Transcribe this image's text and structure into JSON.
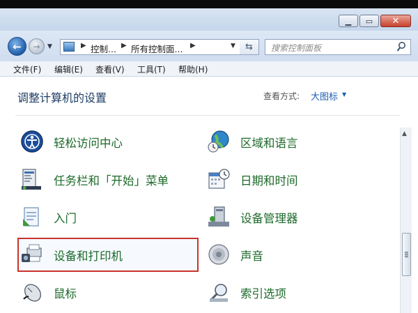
{
  "address_bar": {
    "crumbs": [
      "控制...",
      "所有控制面..."
    ]
  },
  "search": {
    "placeholder": "搜索控制面板"
  },
  "menu": [
    "文件(F)",
    "编辑(E)",
    "查看(V)",
    "工具(T)",
    "帮助(H)"
  ],
  "content": {
    "title": "调整计算机的设置",
    "view_by_label": "查看方式:",
    "view_by_value": "大图标"
  },
  "items": [
    {
      "label": "轻松访问中心",
      "icon": "ease-of-access-icon"
    },
    {
      "label": "区域和语言",
      "icon": "region-language-icon"
    },
    {
      "label": "任务栏和「开始」菜单",
      "icon": "taskbar-start-menu-icon"
    },
    {
      "label": "日期和时间",
      "icon": "date-time-icon"
    },
    {
      "label": "入门",
      "icon": "getting-started-icon"
    },
    {
      "label": "设备管理器",
      "icon": "device-manager-icon"
    },
    {
      "label": "设备和打印机",
      "icon": "devices-printers-icon"
    },
    {
      "label": "声音",
      "icon": "sound-icon"
    },
    {
      "label": "鼠标",
      "icon": "mouse-icon"
    },
    {
      "label": "索引选项",
      "icon": "indexing-options-icon"
    }
  ],
  "colors": {
    "item_label": "#1d6a2a",
    "highlight_border": "#c8332c",
    "link_blue": "#1a5fb0"
  }
}
